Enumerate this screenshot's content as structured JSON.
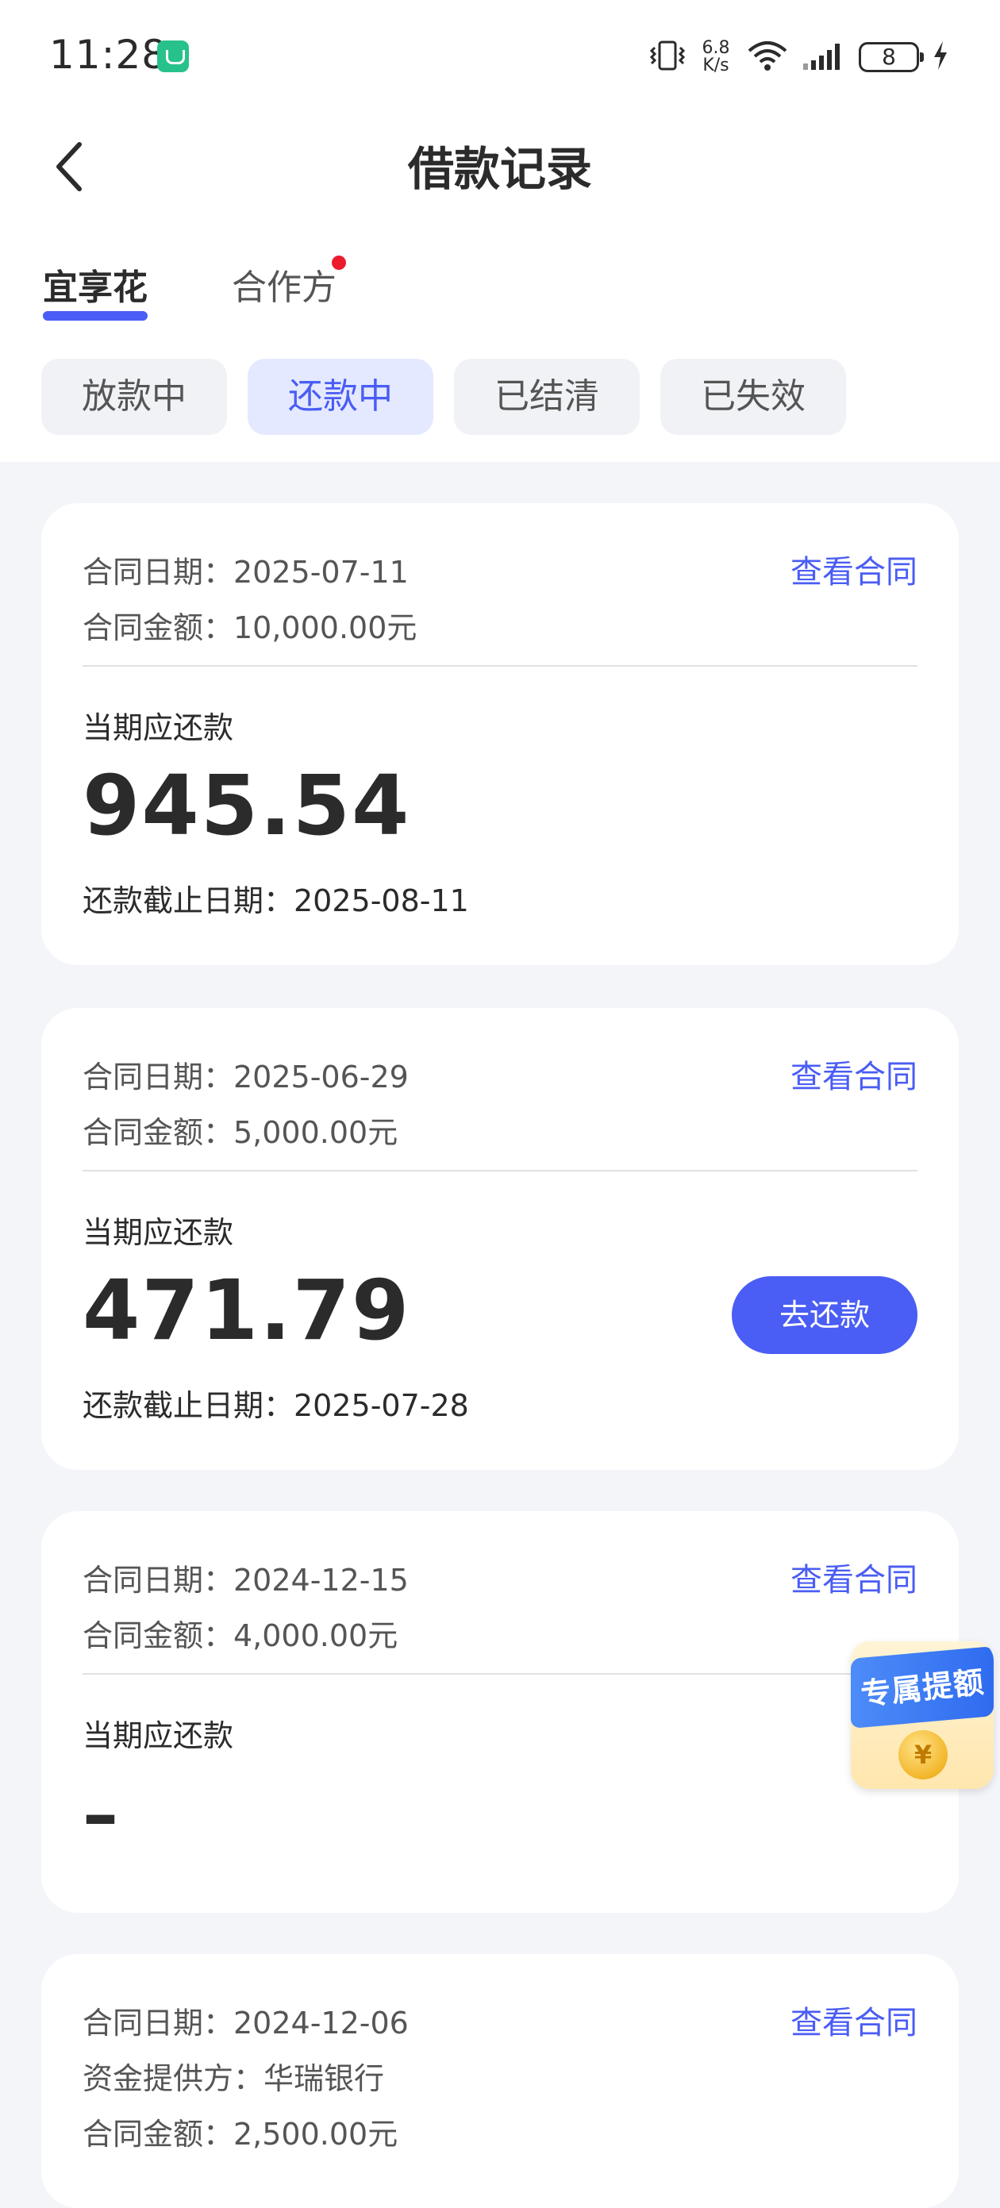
{
  "status_bar": {
    "time": "11:28",
    "net_speed_value": "6.8",
    "net_speed_unit": "K/s",
    "battery_level": "8",
    "icons": [
      "vibrate-icon",
      "wifi-icon",
      "signal-icon",
      "charging-icon"
    ]
  },
  "header": {
    "title": "借款记录",
    "back_icon": "chevron-left-icon"
  },
  "tabs": [
    {
      "label": "宜享花",
      "active": true
    },
    {
      "label": "合作方",
      "active": false,
      "has_dot": true
    }
  ],
  "filters": [
    {
      "label": "放款中",
      "active": false
    },
    {
      "label": "还款中",
      "active": true
    },
    {
      "label": "已结清",
      "active": false
    },
    {
      "label": "已失效",
      "active": false
    }
  ],
  "records": [
    {
      "contract_date": "合同日期：2025-07-11",
      "contract_amount": "合同金额：10,000.00元",
      "view_contract": "查看合同",
      "due_label": "当期应还款",
      "due_amount": "945.54",
      "deadline": "还款截止日期：2025-08-11"
    },
    {
      "contract_date": "合同日期：2025-06-29",
      "contract_amount": "合同金额：5,000.00元",
      "view_contract": "查看合同",
      "due_label": "当期应还款",
      "due_amount": "471.79",
      "deadline": "还款截止日期：2025-07-28",
      "repay_button": "去还款"
    },
    {
      "contract_date": "合同日期：2024-12-15",
      "contract_amount": "合同金额：4,000.00元",
      "view_contract": "查看合同",
      "due_label": "当期应还款",
      "due_amount": "–"
    },
    {
      "contract_date": "合同日期：2024-12-06",
      "fund_provider": "资金提供方：华瑞银行",
      "contract_amount": "合同金额：2,500.00元",
      "view_contract": "查看合同"
    }
  ],
  "promo": {
    "label": "专属提额",
    "coin_symbol": "¥"
  },
  "colors": {
    "accent": "#4a5df4",
    "active_pill_bg": "#e4e9ff",
    "page_bg": "#f4f5f9",
    "tab_dot": "#ec1b2c"
  }
}
